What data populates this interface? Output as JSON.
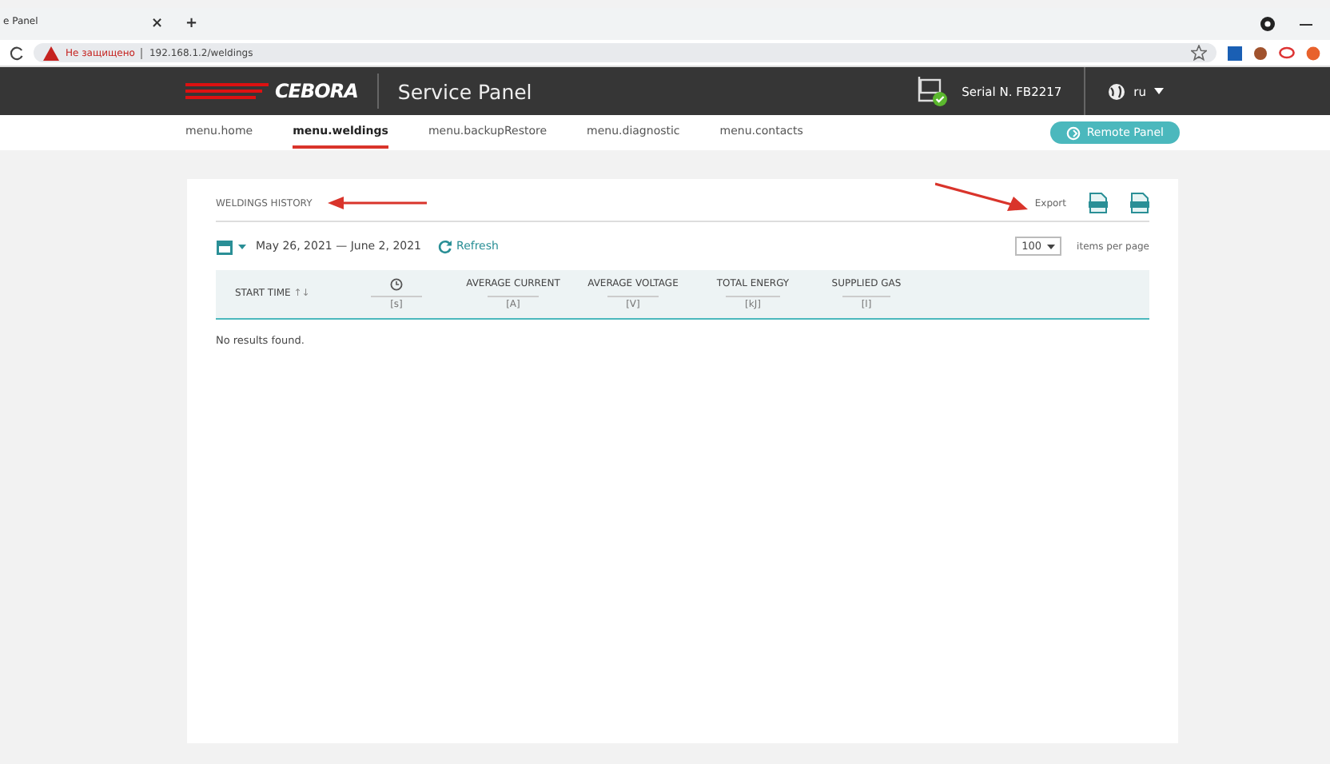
{
  "browser": {
    "tab_title": "e Panel",
    "tab_close": "×",
    "new_tab": "+",
    "security": "Не защищено",
    "url": "192.168.1.2/weldings"
  },
  "header": {
    "logo": "CEBORA",
    "title": "Service Panel",
    "serial": "Serial N. FB2217",
    "language": "ru"
  },
  "nav": {
    "items": [
      {
        "label": "menu.home",
        "selected": false
      },
      {
        "label": "menu.weldings",
        "selected": true
      },
      {
        "label": "menu.backupRestore",
        "selected": false
      },
      {
        "label": "menu.diagnostic",
        "selected": false
      },
      {
        "label": "menu.contacts",
        "selected": false
      }
    ],
    "remote_button": "Remote Panel"
  },
  "card": {
    "title": "WELDINGS HISTORY",
    "export_label": "Export",
    "date_range": "May 26, 2021 — June 2, 2021",
    "refresh": "Refresh",
    "page_size": "100",
    "page_size_label": "items per page",
    "table": {
      "columns": [
        {
          "kind": "text",
          "label": "START TIME",
          "sort": "↑↓"
        },
        {
          "kind": "icon",
          "unit": "[s]"
        },
        {
          "kind": "text",
          "label": "AVERAGE CURRENT",
          "unit": "[A]"
        },
        {
          "kind": "text",
          "label": "AVERAGE VOLTAGE",
          "unit": "[V]"
        },
        {
          "kind": "text",
          "label": "TOTAL ENERGY",
          "unit": "[kJ]"
        },
        {
          "kind": "text",
          "label": "SUPPLIED GAS",
          "unit": "[l]"
        }
      ],
      "empty": "No results found."
    }
  }
}
